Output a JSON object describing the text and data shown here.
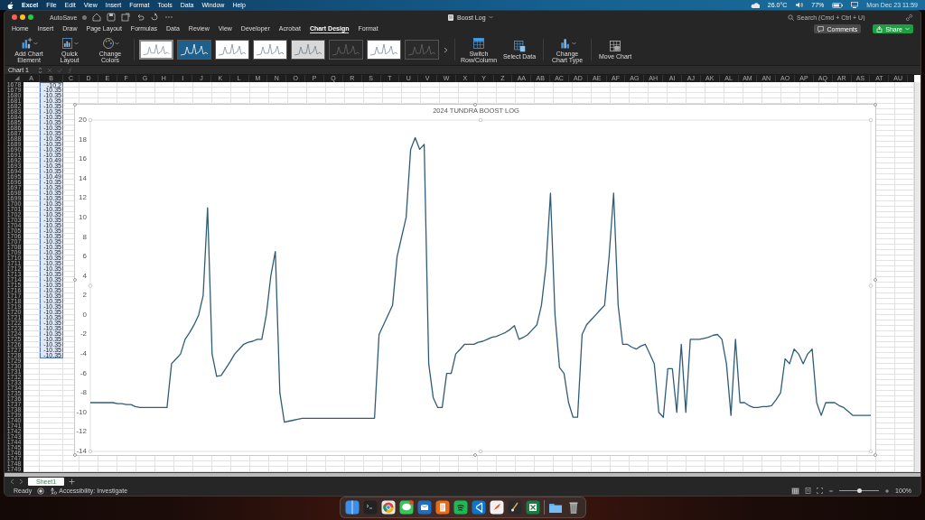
{
  "menu_bar": {
    "app": "Excel",
    "items": [
      "File",
      "Edit",
      "View",
      "Insert",
      "Format",
      "Tools",
      "Data",
      "Window",
      "Help"
    ],
    "temperature": "26.0°C",
    "battery": "77%",
    "clock": "Mon Dec 23  11:59"
  },
  "window": {
    "title": "Boost Log",
    "autosave": {
      "label": "AutoSave",
      "on": false
    }
  },
  "search": {
    "placeholder": "Search (Cmd + Ctrl + U)"
  },
  "buttons": [
    {
      "label": "Comments",
      "kind": "comments"
    },
    {
      "label": "Share",
      "kind": "share"
    }
  ],
  "tabs": [
    {
      "label": "Home",
      "selected": false
    },
    {
      "label": "Insert",
      "selected": false
    },
    {
      "label": "Draw",
      "selected": false
    },
    {
      "label": "Page Layout",
      "selected": false
    },
    {
      "label": "Formulas",
      "selected": false
    },
    {
      "label": "Data",
      "selected": false
    },
    {
      "label": "Review",
      "selected": false
    },
    {
      "label": "View",
      "selected": false
    },
    {
      "label": "Developer",
      "selected": false
    },
    {
      "label": "Acrobat",
      "selected": false
    },
    {
      "label": "Chart Design",
      "selected": true
    },
    {
      "label": "Format",
      "selected": false
    }
  ],
  "ribbon_left": [
    {
      "label": "Add Chart Element",
      "kind": "add"
    },
    {
      "label": "Quick Layout",
      "kind": "layout"
    },
    {
      "label": "Change Colors",
      "kind": "colors"
    }
  ],
  "chart_styles": [
    {
      "kind": "light",
      "selected": true
    },
    {
      "kind": "blue",
      "selected": false
    },
    {
      "kind": "light",
      "selected": false
    },
    {
      "kind": "light",
      "selected": false
    },
    {
      "kind": "gray",
      "selected": false
    },
    {
      "kind": "dark",
      "selected": false
    },
    {
      "kind": "light",
      "selected": false
    },
    {
      "kind": "dark",
      "selected": false
    }
  ],
  "ribbon_right": [
    {
      "label": "Switch Row/Column",
      "kind": "switch"
    },
    {
      "label": "Select Data",
      "kind": "select"
    },
    {
      "label": "Change Chart Type",
      "kind": "type"
    },
    {
      "label": "Move Chart",
      "kind": "move"
    }
  ],
  "name_box": "Chart 1",
  "columns": [
    "A",
    "B",
    "C",
    "D",
    "E",
    "F",
    "G",
    "H",
    "I",
    "J",
    "K",
    "L",
    "M",
    "N",
    "O",
    "P",
    "Q",
    "R",
    "S",
    "T",
    "U",
    "V",
    "W",
    "X",
    "Y",
    "Z",
    "AA",
    "AB",
    "AC",
    "AD",
    "AE",
    "AF",
    "AG",
    "AH",
    "AI",
    "AJ",
    "AK",
    "AL",
    "AM",
    "AN",
    "AO",
    "AP",
    "AQ",
    "AR",
    "AS",
    "AT",
    "AU"
  ],
  "rows": [
    {
      "number": "1678",
      "b": "-10.2",
      "selected": true
    },
    {
      "number": "1679",
      "b": "-10.35",
      "selected": true
    },
    {
      "number": "1680",
      "b": "-10.35",
      "selected": true
    },
    {
      "number": "1681",
      "b": "-10.35",
      "selected": true
    },
    {
      "number": "1682",
      "b": "-10.35",
      "selected": true
    },
    {
      "number": "1683",
      "b": "-10.35",
      "selected": true
    },
    {
      "number": "1684",
      "b": "-10.35",
      "selected": true
    },
    {
      "number": "1685",
      "b": "-10.35",
      "selected": true
    },
    {
      "number": "1686",
      "b": "-10.35",
      "selected": true
    },
    {
      "number": "1687",
      "b": "-10.35",
      "selected": true
    },
    {
      "number": "1688",
      "b": "-10.35",
      "selected": true
    },
    {
      "number": "1689",
      "b": "-10.35",
      "selected": true
    },
    {
      "number": "1690",
      "b": "-10.35",
      "selected": true
    },
    {
      "number": "1691",
      "b": "-10.35",
      "selected": true
    },
    {
      "number": "1692",
      "b": "-10.49",
      "selected": true
    },
    {
      "number": "1693",
      "b": "-10.35",
      "selected": true
    },
    {
      "number": "1694",
      "b": "-10.35",
      "selected": true
    },
    {
      "number": "1695",
      "b": "-10.49",
      "selected": true
    },
    {
      "number": "1696",
      "b": "-10.35",
      "selected": true
    },
    {
      "number": "1697",
      "b": "-10.35",
      "selected": true
    },
    {
      "number": "1698",
      "b": "-10.35",
      "selected": true
    },
    {
      "number": "1699",
      "b": "-10.35",
      "selected": true
    },
    {
      "number": "1700",
      "b": "-10.35",
      "selected": true
    },
    {
      "number": "1701",
      "b": "-10.35",
      "selected": true
    },
    {
      "number": "1702",
      "b": "-10.35",
      "selected": true
    },
    {
      "number": "1703",
      "b": "-10.35",
      "selected": true
    },
    {
      "number": "1704",
      "b": "-10.35",
      "selected": true
    },
    {
      "number": "1705",
      "b": "-10.35",
      "selected": true
    },
    {
      "number": "1706",
      "b": "-10.35",
      "selected": true
    },
    {
      "number": "1707",
      "b": "-10.35",
      "selected": true
    },
    {
      "number": "1708",
      "b": "-10.35",
      "selected": true
    },
    {
      "number": "1709",
      "b": "-10.35",
      "selected": true
    },
    {
      "number": "1710",
      "b": "-10.35",
      "selected": true
    },
    {
      "number": "1711",
      "b": "-10.35",
      "selected": true
    },
    {
      "number": "1712",
      "b": "-10.35",
      "selected": true
    },
    {
      "number": "1713",
      "b": "-10.35",
      "selected": true
    },
    {
      "number": "1714",
      "b": "-10.35",
      "selected": true
    },
    {
      "number": "1715",
      "b": "-10.35",
      "selected": true
    },
    {
      "number": "1716",
      "b": "-10.35",
      "selected": true
    },
    {
      "number": "1717",
      "b": "-10.35",
      "selected": true
    },
    {
      "number": "1718",
      "b": "-10.35",
      "selected": true
    },
    {
      "number": "1719",
      "b": "-10.35",
      "selected": true
    },
    {
      "number": "1720",
      "b": "-10.35",
      "selected": true
    },
    {
      "number": "1721",
      "b": "-10.35",
      "selected": true
    },
    {
      "number": "1722",
      "b": "-10.35",
      "selected": true
    },
    {
      "number": "1723",
      "b": "-10.35",
      "selected": true
    },
    {
      "number": "1724",
      "b": "-10.35",
      "selected": true
    },
    {
      "number": "1725",
      "b": "-10.35",
      "selected": true
    },
    {
      "number": "1726",
      "b": "-10.35",
      "selected": true
    },
    {
      "number": "1727",
      "b": "-10.35",
      "selected": true
    },
    {
      "number": "1728",
      "b": "-10.35",
      "selected": true
    },
    {
      "number": "1729",
      "selected": false
    },
    {
      "number": "1730",
      "selected": false
    },
    {
      "number": "1731",
      "selected": false
    },
    {
      "number": "1732",
      "selected": false
    },
    {
      "number": "1733",
      "selected": false
    },
    {
      "number": "1734",
      "selected": false
    },
    {
      "number": "1735",
      "selected": false
    },
    {
      "number": "1736",
      "selected": false
    },
    {
      "number": "1737",
      "selected": false
    },
    {
      "number": "1738",
      "selected": false
    },
    {
      "number": "1739",
      "selected": false
    },
    {
      "number": "1740",
      "selected": false
    },
    {
      "number": "1741",
      "selected": false
    },
    {
      "number": "1742",
      "selected": false
    },
    {
      "number": "1743",
      "selected": false
    },
    {
      "number": "1744",
      "selected": false
    },
    {
      "number": "1745",
      "selected": false
    },
    {
      "number": "1746",
      "selected": false
    },
    {
      "number": "1747",
      "selected": false
    },
    {
      "number": "1748",
      "selected": false
    },
    {
      "number": "1749",
      "selected": false
    }
  ],
  "chart": {
    "chart_data": {
      "type": "line",
      "title": "2024 TUNDRA BOOST LOG",
      "ylim": [
        -14,
        20
      ],
      "yticks": [
        -14,
        -12,
        -10,
        -8,
        -6,
        -4,
        -2,
        0,
        2,
        4,
        6,
        8,
        10,
        12,
        14,
        16,
        18,
        20
      ],
      "categories": [
        null,
        null,
        null,
        null,
        null,
        null,
        null,
        null,
        null,
        null,
        null,
        null,
        null,
        null,
        null,
        null,
        null,
        null,
        null,
        null,
        null,
        null,
        null,
        null,
        null,
        null,
        null,
        null,
        null,
        null,
        null,
        null,
        null,
        null,
        null,
        null,
        null,
        null,
        null,
        null,
        null,
        null,
        null,
        null,
        null,
        null,
        null,
        null,
        null,
        null,
        null,
        null,
        null,
        null,
        null,
        null,
        null,
        null,
        null,
        null,
        null,
        null,
        null,
        null,
        null,
        null,
        null,
        null,
        null,
        null,
        null,
        null,
        null,
        null,
        null,
        null,
        null,
        null,
        null,
        null,
        null,
        null,
        null,
        null,
        null,
        null,
        null,
        null,
        null,
        null,
        null,
        null,
        null,
        null,
        null,
        null,
        null,
        null,
        null,
        null,
        null,
        null,
        null,
        null,
        null,
        null,
        null,
        null,
        null,
        null,
        null,
        null,
        null,
        null,
        null,
        null,
        null,
        null,
        null,
        null,
        null,
        null,
        null,
        null,
        null,
        null,
        null,
        null,
        null,
        null,
        null,
        null,
        null,
        null,
        null,
        null,
        null,
        null,
        null,
        null,
        null,
        null,
        null,
        null,
        null,
        null,
        null,
        null,
        null,
        null,
        null,
        null,
        null,
        null,
        null,
        null,
        null,
        null,
        null,
        null,
        null,
        null,
        null,
        null,
        null,
        null,
        null,
        null,
        null,
        null,
        null,
        null,
        null,
        null
      ],
      "series": [
        {
          "color": "#2f5d78",
          "values": [
            -9,
            -9,
            -9,
            -9,
            -9,
            -9,
            -9.1,
            -9.1,
            -9.2,
            -9.2,
            -9.4,
            -9.5,
            -9.5,
            -9.5,
            -9.5,
            -9.5,
            -9.5,
            -9.5,
            -5,
            -4.5,
            -4,
            -2.5,
            -1.8,
            -1,
            0,
            2,
            11,
            -4,
            -6.3,
            -6.2,
            -5.5,
            -4.8,
            -4,
            -3.5,
            -3,
            -2.8,
            -2.7,
            -2.5,
            -2.5,
            0,
            4,
            6.5,
            -8,
            -11,
            -10.9,
            -10.8,
            -10.7,
            -10.6,
            -10.6,
            -10.6,
            -10.6,
            -10.6,
            -10.6,
            -10.6,
            -10.6,
            -10.6,
            -10.6,
            -10.6,
            -10.6,
            -10.6,
            -10.6,
            -10.6,
            -10.6,
            -10.6,
            -2,
            -1,
            0,
            1,
            6,
            8,
            10,
            17,
            18.2,
            17,
            17.5,
            -5,
            -8.5,
            -9.5,
            -9.5,
            -6,
            -6,
            -4,
            -3.5,
            -3,
            -3,
            -3,
            -2.8,
            -2.7,
            -2.5,
            -2.3,
            -2.2,
            -2,
            -1.8,
            -1.5,
            -1.1,
            -2.5,
            -2.3,
            -2,
            -1.5,
            -1,
            1,
            5,
            12.5,
            0,
            -5.4,
            -6,
            -9,
            -10.5,
            -10.5,
            -2,
            -1,
            -0.5,
            0,
            0.5,
            1,
            6,
            12.5,
            1,
            -3,
            -3,
            -3.3,
            -3.5,
            -3.2,
            -3,
            -4,
            -5,
            -10,
            -10.5,
            -5.5,
            -5.5,
            -10,
            -3,
            -10,
            -2.5,
            -2.5,
            -2.5,
            -2.4,
            -2.3,
            -2.1,
            -2,
            -2.5,
            -5,
            -10.3,
            -2.5,
            -9,
            -9,
            -9.3,
            -9.5,
            -9.5,
            -9.4,
            -9.4,
            -9.3,
            -8.7,
            -8,
            -4.5,
            -5,
            -3.5,
            -4,
            -5,
            -4,
            -3.5,
            -9,
            -10.3,
            -9,
            -9,
            -9,
            -9.3,
            -9.5,
            -9.9,
            -10.3,
            -10.3,
            -10.3,
            -10.3,
            -10.3
          ]
        }
      ]
    }
  },
  "sheet_tabs": [
    {
      "label": "Sheet1",
      "selected": true
    }
  ],
  "status_bar": {
    "mode": "Ready",
    "accessibility": "Accessibility: Investigate",
    "zoom": "100%",
    "zoom_slider": {
      "level": 0.5
    }
  }
}
